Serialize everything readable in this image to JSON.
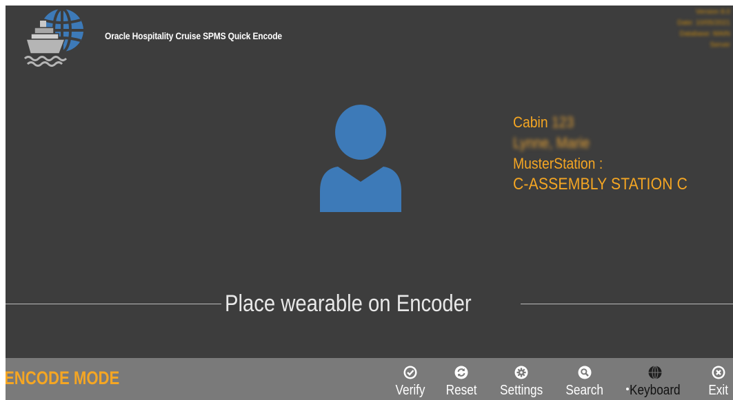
{
  "app": {
    "title": "Oracle Hospitality Cruise SPMS Quick Encode",
    "logo_icon": "ship-globe-logo-icon"
  },
  "version_info": {
    "lines": [
      "Version 8.0",
      "Date: 10/05/2021",
      "Database: MAIN",
      "Server"
    ],
    "blurred": true
  },
  "guest": {
    "avatar_icon": "person-avatar-icon",
    "cabin_label": "Cabin",
    "cabin_number": "123",
    "name": "Lynne, Marie",
    "muster_label": "MusterStation :",
    "muster_station": "C-ASSEMBLY STATION C"
  },
  "prompt": {
    "text": "Place wearable on Encoder"
  },
  "toolbar": {
    "mode_label": "ENCODE MODE",
    "buttons": [
      {
        "label": "Verify",
        "icon": "check-circle-icon"
      },
      {
        "label": "Reset",
        "icon": "refresh-icon"
      },
      {
        "label": "Settings",
        "icon": "gear-icon"
      },
      {
        "label": "Search",
        "icon": "search-icon"
      },
      {
        "label": "Keyboard",
        "icon": "keyboard-globe-icon",
        "active": true
      },
      {
        "label": "Exit",
        "icon": "close-circle-icon"
      }
    ]
  },
  "colors": {
    "background": "#3d3d3d",
    "toolbar": "#7a7a7a",
    "accent": "#f5a623",
    "avatar": "#3d7ab8"
  }
}
